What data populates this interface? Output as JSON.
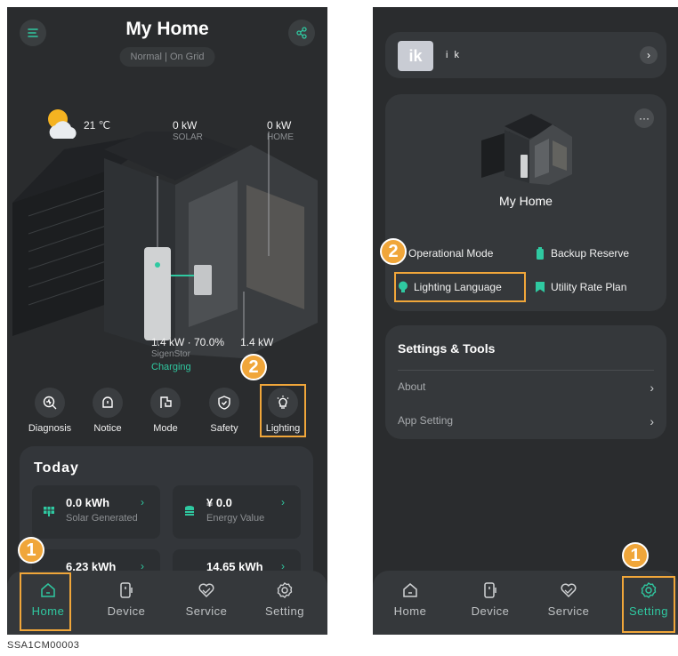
{
  "left": {
    "title": "My Home",
    "status": "Normal | On Grid",
    "weather": {
      "temperature": "21 ℃",
      "icon": "partly-cloudy-icon"
    },
    "flows": {
      "solar": {
        "value": "0 kW",
        "label": "SOLAR"
      },
      "home": {
        "value": "0 kW",
        "label": "HOME"
      },
      "battery": {
        "value": "1.4 kW · 70.0%",
        "name": "SigenStor",
        "state": "Charging"
      },
      "grid": {
        "value": "1.4 kW"
      }
    },
    "quick_actions": [
      {
        "label": "Diagnosis",
        "icon": "diagnosis-icon"
      },
      {
        "label": "Notice",
        "icon": "notice-icon"
      },
      {
        "label": "Mode",
        "icon": "mode-icon"
      },
      {
        "label": "Safety",
        "icon": "safety-icon"
      },
      {
        "label": "Lighting",
        "icon": "lighting-icon"
      }
    ],
    "today": {
      "title": "Today",
      "stats": [
        {
          "value": "0.0 kWh",
          "caption": "Solar Generated"
        },
        {
          "value": "¥ 0.0",
          "caption": "Energy Value"
        },
        {
          "value": "6.23 kWh",
          "caption": ""
        },
        {
          "value": "14.65 kWh",
          "caption": ""
        }
      ]
    },
    "tabs": [
      "Home",
      "Device",
      "Service",
      "Setting"
    ],
    "active_tab": "Home"
  },
  "right": {
    "user": {
      "initials": "ik",
      "name": "i k"
    },
    "home_name": "My Home",
    "menu": {
      "operational_mode": "Operational Mode",
      "backup_reserve": "Backup Reserve",
      "lighting_language": "Lighting Language",
      "utility_rate_plan": "Utility Rate Plan"
    },
    "settings": {
      "title": "Settings & Tools",
      "about": "About",
      "app_setting": "App Setting"
    },
    "tabs": [
      "Home",
      "Device",
      "Service",
      "Setting"
    ],
    "active_tab": "Setting"
  },
  "annotations": {
    "step1": "1",
    "step2": "2"
  },
  "caption": "SSA1CM00003",
  "colors": {
    "accent": "#2fc9a1",
    "highlight": "#f0a63a",
    "background": "#2a2c2e"
  }
}
